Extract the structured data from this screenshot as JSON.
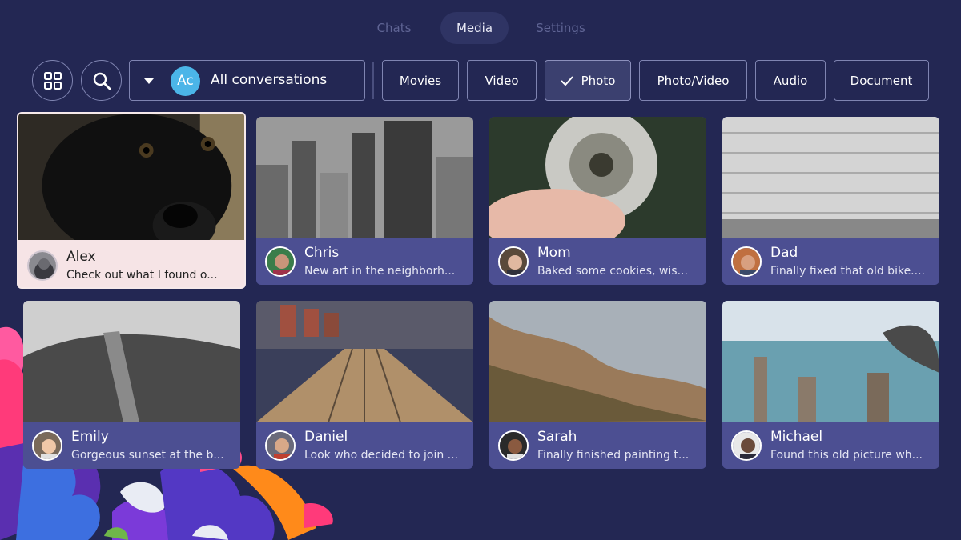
{
  "nav": {
    "tabs": [
      {
        "label": "Chats"
      },
      {
        "label": "Media"
      },
      {
        "label": "Settings"
      }
    ],
    "active": "Media"
  },
  "toolbar": {
    "grid_icon": "grid-icon",
    "search_icon": "search-icon",
    "conversation": {
      "avatar_text": "Ac",
      "label": "All conversations"
    },
    "filters": [
      {
        "label": "Movies"
      },
      {
        "label": "Video"
      },
      {
        "label": "Photo",
        "checked": true
      },
      {
        "label": "Photo/Video"
      },
      {
        "label": "Audio"
      },
      {
        "label": "Document"
      }
    ]
  },
  "cards": [
    {
      "name": "Alex",
      "message": "Check out what I found o...",
      "selected": true
    },
    {
      "name": "Chris",
      "message": "New art in the neighborh..."
    },
    {
      "name": "Mom",
      "message": "Baked some cookies, wis..."
    },
    {
      "name": "Dad",
      "message": "Finally fixed that old bike...."
    },
    {
      "name": "Emily",
      "message": "Gorgeous sunset at the b..."
    },
    {
      "name": "Daniel",
      "message": "Look who decided to join ..."
    },
    {
      "name": "Sarah",
      "message": "Finally finished painting t..."
    },
    {
      "name": "Michael",
      "message": "Found this old picture wh..."
    }
  ],
  "colors": {
    "background": "#232753",
    "card": "#4c4f92",
    "selected_card": "#f6e4e6",
    "accent": "#4bb5e8"
  }
}
